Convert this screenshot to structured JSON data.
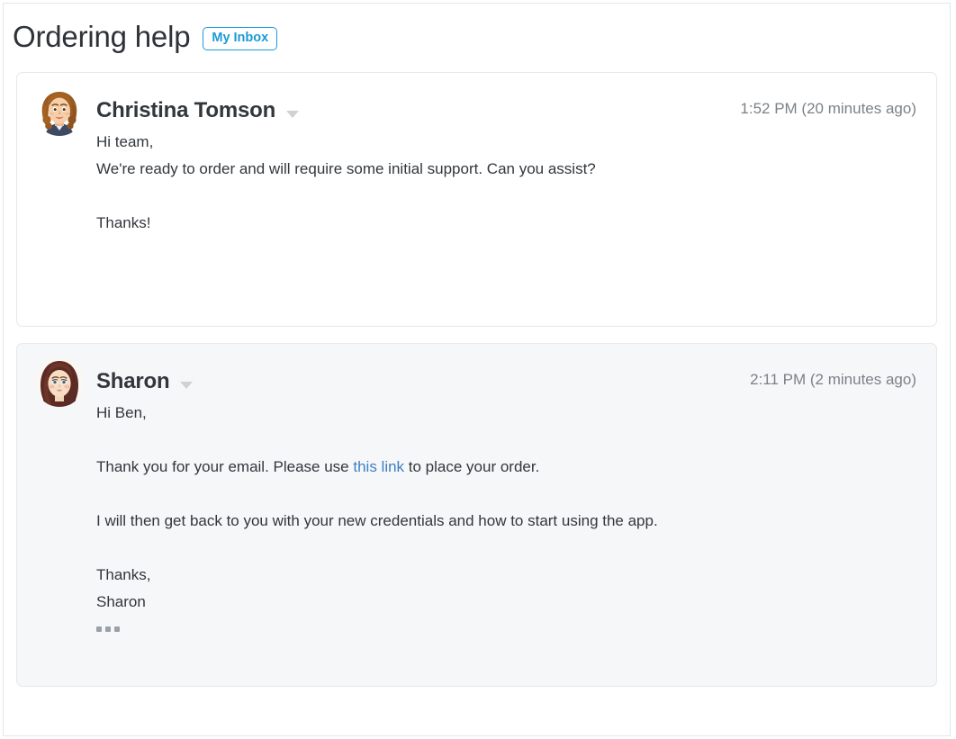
{
  "header": {
    "title": "Ordering help",
    "inbox_badge_label": "My Inbox",
    "badge_color": "#1b9ad7"
  },
  "colors": {
    "text": "#32373c",
    "muted": "#7b8287",
    "link": "#3f7fc1",
    "card_border": "#e6e8ea",
    "card_bg_unread": "#ffffff",
    "card_bg_read": "#f6f7f9"
  },
  "messages": [
    {
      "id": "message-christina",
      "sender": "Christina Tomson",
      "avatar_name": "avatar-christina-tomson",
      "timestamp": "1:52 PM (20 minutes ago)",
      "caret_name": "sender-options-caret",
      "background": "white",
      "lines": [
        "Hi team,",
        "We're ready to order and will require some initial support. Can you assist?",
        "",
        "Thanks!"
      ],
      "has_trim_dots": false
    },
    {
      "id": "message-sharon",
      "sender": "Sharon",
      "avatar_name": "avatar-sharon",
      "timestamp": "2:11 PM (2 minutes ago)",
      "caret_name": "sender-options-caret",
      "background": "grey",
      "lines": [
        "Hi Ben,",
        "Thank you for your email. Please use ",
        "this link",
        " to place your order.",
        "I will then get back to you with your new credentials and how to start using the app.",
        "Thanks,",
        "Sharon"
      ],
      "link_text": "this link",
      "has_trim_dots": true,
      "trim_dots_name": "show-trimmed-content-button"
    }
  ]
}
